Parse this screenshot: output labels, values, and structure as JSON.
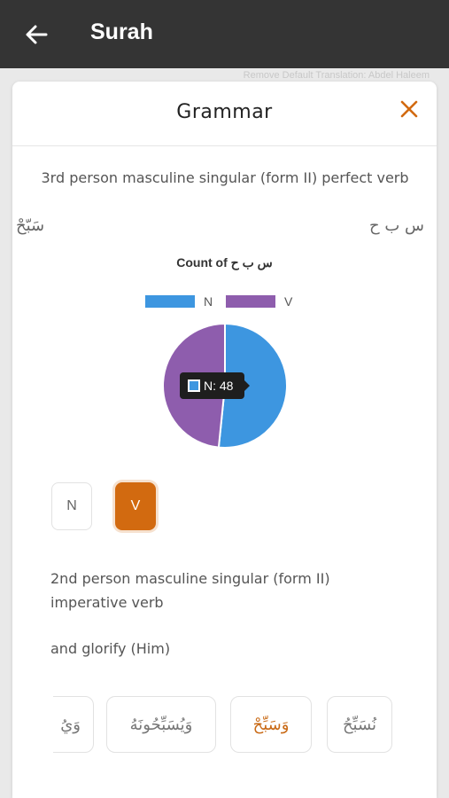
{
  "appbar": {
    "title": "Surah",
    "back_icon": "back-arrow-icon"
  },
  "background_hint": "Remove Default Translation: Abdel Haleem",
  "dialog": {
    "title": "Grammar",
    "close_icon": "close-icon",
    "description": "3rd person masculine singular (form II) perfect verb",
    "arabic_word": "سَبّحْ",
    "arabic_root": "س ب ح",
    "chart_title": "Count of س ب ح",
    "tooltip_label": "N: 48",
    "toggles": [
      "N",
      "V"
    ],
    "selected_toggle": "V",
    "selected_description": "2nd person masculine singular (form II) imperative verb",
    "gloss": "and glorify (Him)",
    "word_chips": [
      "نُسَبِّحُ",
      "وَسَبِّحْ",
      "وَيُسَبِّحُونَهُ",
      "وَيُ"
    ],
    "selected_chip_index": 1
  },
  "colors": {
    "appbar": "#343434",
    "N": "#3d96e0",
    "V": "#8e5dad",
    "accent": "#d26a10"
  },
  "chart_data": {
    "type": "pie",
    "title": "Count of س ب ح",
    "legend": [
      "N",
      "V"
    ],
    "legend_position": "top",
    "series": [
      {
        "name": "N",
        "value": 48
      },
      {
        "name": "V",
        "value": 45
      }
    ]
  }
}
